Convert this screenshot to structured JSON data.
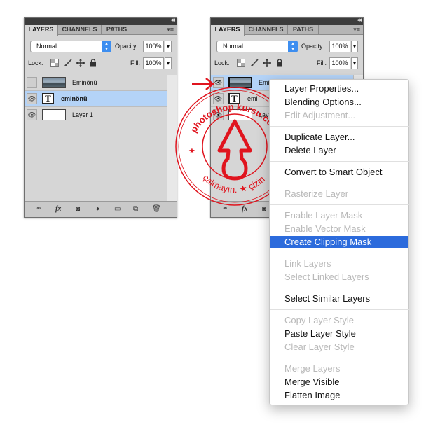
{
  "left_panel": {
    "tabs": [
      "LAYERS",
      "CHANNELS",
      "PATHS"
    ],
    "blend_mode": "Normal",
    "opacity_label": "Opacity:",
    "opacity_value": "100%",
    "lock_label": "Lock:",
    "fill_label": "Fill:",
    "fill_value": "100%",
    "layers": [
      {
        "name": "Eminönü",
        "kind": "photo",
        "visible": false,
        "selected": false
      },
      {
        "name": "eminönü",
        "kind": "text",
        "visible": true,
        "selected": true
      },
      {
        "name": "Layer 1",
        "kind": "blank",
        "visible": true,
        "selected": false
      }
    ]
  },
  "right_panel": {
    "tabs": [
      "LAYERS",
      "CHANNELS",
      "PATHS"
    ],
    "blend_mode": "Normal",
    "opacity_label": "Opacity:",
    "opacity_value": "100%",
    "lock_label": "Lock:",
    "fill_label": "Fill:",
    "fill_value": "100%",
    "layers": [
      {
        "name": "Eminö",
        "kind": "photo",
        "visible": true,
        "selected": true
      },
      {
        "name": "emi",
        "kind": "text",
        "visible": true,
        "selected": false
      },
      {
        "name": "Laye",
        "kind": "blank",
        "visible": true,
        "selected": false
      }
    ]
  },
  "context_menu": {
    "items": [
      {
        "label": "Layer Properties...",
        "state": "enabled"
      },
      {
        "label": "Blending Options...",
        "state": "enabled"
      },
      {
        "label": "Edit Adjustment...",
        "state": "disabled"
      },
      {
        "separator": true
      },
      {
        "label": "Duplicate Layer...",
        "state": "enabled"
      },
      {
        "label": "Delete Layer",
        "state": "enabled"
      },
      {
        "separator": true
      },
      {
        "label": "Convert to Smart Object",
        "state": "enabled"
      },
      {
        "separator": true
      },
      {
        "label": "Rasterize Layer",
        "state": "disabled"
      },
      {
        "separator": true
      },
      {
        "label": "Enable Layer Mask",
        "state": "disabled"
      },
      {
        "label": "Enable Vector Mask",
        "state": "disabled"
      },
      {
        "label": "Create Clipping Mask",
        "state": "highlighted"
      },
      {
        "separator": true
      },
      {
        "label": "Link Layers",
        "state": "disabled"
      },
      {
        "label": "Select Linked Layers",
        "state": "disabled"
      },
      {
        "separator": true
      },
      {
        "label": "Select Similar Layers",
        "state": "enabled"
      },
      {
        "separator": true
      },
      {
        "label": "Copy Layer Style",
        "state": "disabled"
      },
      {
        "label": "Paste Layer Style",
        "state": "enabled"
      },
      {
        "label": "Clear Layer Style",
        "state": "disabled"
      },
      {
        "separator": true
      },
      {
        "label": "Merge Layers",
        "state": "disabled"
      },
      {
        "label": "Merge Visible",
        "state": "enabled"
      },
      {
        "label": "Flatten Image",
        "state": "enabled"
      }
    ]
  },
  "watermark": {
    "top_text": "photoshop.kursu.com",
    "bottom_text": "çalmayın. ★ çizin.",
    "color": "#e0141e"
  },
  "colors": {
    "selection": "#b4d3f7",
    "menu_highlight": "#2c6bdc",
    "accent_blue": "#3d8ef0"
  }
}
